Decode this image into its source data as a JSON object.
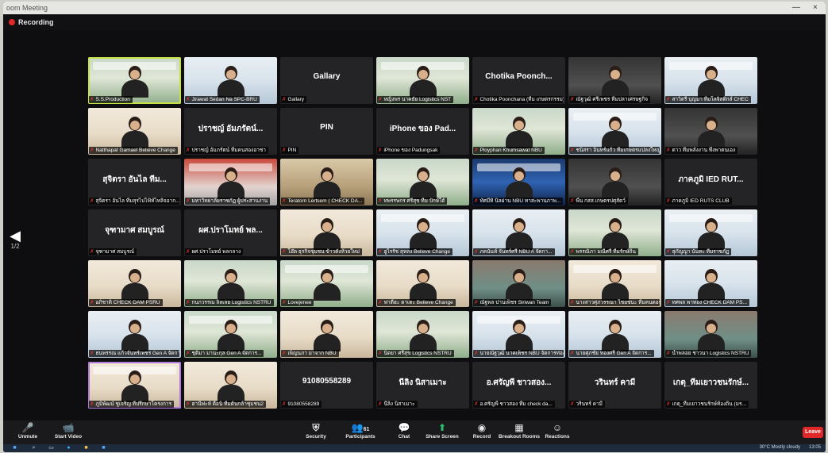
{
  "window": {
    "title": "oom Meeting",
    "minimize": "—",
    "close": "×"
  },
  "recording": {
    "label": "Recording"
  },
  "pager": {
    "arrow": "◀",
    "page": "1/2"
  },
  "tiles": [
    {
      "name": "S.S.Production",
      "kind": "vid",
      "variant": "",
      "center": "",
      "active": true
    },
    {
      "name": "Jirawat Sedan Na SPC-BRU",
      "kind": "vid",
      "variant": "b",
      "center": ""
    },
    {
      "name": "Gallary",
      "kind": "name",
      "center": "Gallary"
    },
    {
      "name": "หญิงพร นาคธัย Logistics NST",
      "kind": "vid",
      "variant": "",
      "center": ""
    },
    {
      "name": "Chotika Poonchana (ทีม เกษตรกรรม)",
      "kind": "name",
      "center": "Chotika Poonch..."
    },
    {
      "name": "ณัฐวุฒิ ศรีเพชร ทีมปลาเศรษฐกิจ",
      "kind": "vid",
      "variant": "e",
      "center": ""
    },
    {
      "name": "สาวิตรี บุญมา ทีมโลจิสติกส์ CHEC",
      "kind": "vid",
      "variant": "b",
      "center": ""
    },
    {
      "name": "Natthapat Gamael Believe Change",
      "kind": "vid",
      "variant": "c",
      "center": ""
    },
    {
      "name": "ปราชญ์ อัมภรัตน์ ทีมคนสองอาชา",
      "kind": "name",
      "center": "ปราชญ์ อัมภรัตน์..."
    },
    {
      "name": "PIN",
      "kind": "name",
      "center": "PIN"
    },
    {
      "name": "iPhone ของ Padungsak",
      "kind": "name",
      "center": "iPhone ของ Pad..."
    },
    {
      "name": "Ployphan Khumsawat NBU",
      "kind": "vid",
      "variant": "",
      "center": ""
    },
    {
      "name": "ชนิสรา อินทร์แก้ว ทีมเกษตรแปลงใหญ่",
      "kind": "vid",
      "variant": "b",
      "center": ""
    },
    {
      "name": "ดาว ทีมพลังงาน พึ่งพาตนเอง",
      "kind": "vid",
      "variant": "e",
      "center": ""
    },
    {
      "name": "สุจิตรา อันไล ทีมสุรไปไฟ้ท์ไหลิจอาก...",
      "kind": "name",
      "center": "สุจิตรา อันไล ทีม..."
    },
    {
      "name": "มหาวิทยาลัยราชภัฏ ผู้ประสานงาน",
      "kind": "vid",
      "variant": "f",
      "center": ""
    },
    {
      "name": "Teratorn Lertsem ( CHECK DA...",
      "kind": "vid",
      "variant": "g",
      "center": ""
    },
    {
      "name": "ทพรรษกร ศรีสุข ทีม ปักษ์ใต้",
      "kind": "vid",
      "variant": "",
      "center": ""
    },
    {
      "name": "ทัศมีทิ นิลผ่าน NBU ทาสะพานภาพ...",
      "kind": "vid",
      "variant": "d",
      "center": ""
    },
    {
      "name": "พีน กสส.เกษตรปศุสัตว์",
      "kind": "vid",
      "variant": "e",
      "center": ""
    },
    {
      "name": "ภาคภูมิ IED RUTS CLUB",
      "kind": "name",
      "center": "ภาคภูมิ IED RUT..."
    },
    {
      "name": "จุฑามาศ สมบูรณ์",
      "kind": "name",
      "center": "จุฑามาศ สมบูรณ์"
    },
    {
      "name": "ผศ.ปราโมทย์ พลกลาง",
      "kind": "name",
      "center": "ผศ.ปราโมทย์ พล..."
    },
    {
      "name": "โอ๊ต ธุรกิจชุมชน ข้าวตังห้วยใหม่",
      "kind": "vid",
      "variant": "c",
      "center": ""
    },
    {
      "name": "ฮูไรรัช สุหลง Believe Change",
      "kind": "vid",
      "variant": "b",
      "center": ""
    },
    {
      "name": "ภคนันท์ จันทร์ศรี NBU A จัดกา...",
      "kind": "vid",
      "variant": "b",
      "center": ""
    },
    {
      "name": "พรรณิภา มณีศรี ทีมรักษ์ถิ่น",
      "kind": "vid",
      "variant": "",
      "center": ""
    },
    {
      "name": "สุภัญญา นันทะ ทีมราชภัฏ",
      "kind": "vid",
      "variant": "b",
      "center": ""
    },
    {
      "name": "อภิชาติ CHECK DAM PSRU",
      "kind": "vid",
      "variant": "c",
      "center": ""
    },
    {
      "name": "กนกวรรณ ลิลเลย Logistics NSTRU",
      "kind": "vid",
      "variant": "",
      "center": ""
    },
    {
      "name": "Lovejenee",
      "kind": "vid",
      "variant": "",
      "center": ""
    },
    {
      "name": "ฟาตีฮะ ดาเตะ Believe Change",
      "kind": "vid",
      "variant": "c",
      "center": ""
    },
    {
      "name": "ณัฐพล ปานเพ็ชร Siriwan Team",
      "kind": "vid",
      "variant": "h",
      "center": ""
    },
    {
      "name": "นางสาวศุภวรรณา ไชยชนะ ทีมคนดอน",
      "kind": "vid",
      "variant": "c",
      "center": ""
    },
    {
      "name": "ทศพล พาทอง CHECK DAM PS...",
      "kind": "vid",
      "variant": "b",
      "center": ""
    },
    {
      "name": "ธนพรรณ แก้วจันทร์เพชร Gen A จัดการ...",
      "kind": "vid",
      "variant": "b",
      "center": ""
    },
    {
      "name": "ชุติมา มานะกุล Gen A จัดการ...",
      "kind": "vid",
      "variant": "",
      "center": ""
    },
    {
      "name": "เพ็ญนภา มาจาก NBU",
      "kind": "vid",
      "variant": "c",
      "center": ""
    },
    {
      "name": "นิตยา ศรีสุข Logistics NSTRU",
      "kind": "vid",
      "variant": "",
      "center": ""
    },
    {
      "name": "นายณัฐวุฒิ นาคเพ็ชร NBU จัดการท่องเที่ยว",
      "kind": "vid",
      "variant": "b",
      "center": ""
    },
    {
      "name": "นายศุภชัย ทองศรี Gen A จัดการ...",
      "kind": "vid",
      "variant": "b",
      "center": ""
    },
    {
      "name": "น้ำพลอย ชาวนา Logistics NSTRU",
      "kind": "vid",
      "variant": "h",
      "center": ""
    },
    {
      "name": "ภูมิพัฒน์ ชูเจริญ ที่ปรึกษาโครงการ",
      "kind": "vid",
      "variant": "c",
      "center": "",
      "selected": true
    },
    {
      "name": "ฮานีฟะห์ ดือนิ ทีมต้นกล้าชุมชน2",
      "kind": "vid",
      "variant": "c",
      "center": ""
    },
    {
      "name": "91080558289",
      "kind": "name",
      "center": "91080558289"
    },
    {
      "name": "นีลิง นิสาเมาะ",
      "kind": "name",
      "center": "นีลิง นิสาเมาะ"
    },
    {
      "name": "อ.ศรัญพี ชาวสอง ทีม check da...",
      "kind": "name",
      "center": "อ.ศรัญพี ชาวสอง..."
    },
    {
      "name": "วรินทร์ คามี",
      "kind": "name",
      "center": "วรินทร์ คามี"
    },
    {
      "name": "เกตุ_ทีมเยาวชนรักษ์ท้องถิ่น (มร...",
      "kind": "name",
      "center": "เกตุ_ทีมเยาวชนรักษ์..."
    }
  ],
  "toolbar": {
    "unmute": "Unmute",
    "start_video": "Start Video",
    "security": "Security",
    "participants": "Participants",
    "participants_count": "61",
    "chat": "Chat",
    "share_screen": "Share Screen",
    "record": "Record",
    "breakout": "Breakout Rooms",
    "reactions": "Reactions",
    "leave": "Leave"
  },
  "taskbar": {
    "sys": "30°C  Mostly cloudy",
    "time": "13:05"
  }
}
